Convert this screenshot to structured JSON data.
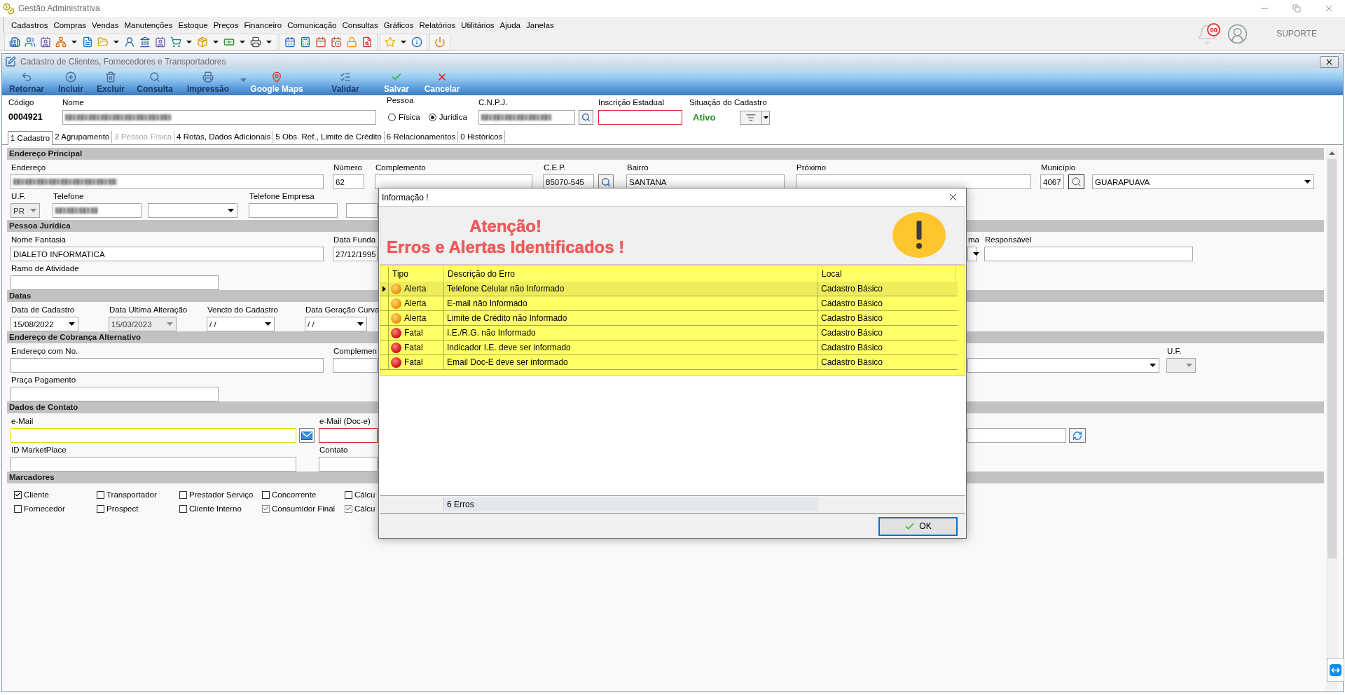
{
  "window": {
    "title": "Gestão Administrativa"
  },
  "menu": [
    "Cadastros",
    "Compras",
    "Vendas",
    "Manutenções",
    "Estoque",
    "Preços",
    "Financeiro",
    "Comunicação",
    "Consultas",
    "Gráficos",
    "Relatórios",
    "Utilitários",
    "Ajuda",
    "Janelas"
  ],
  "user_area": {
    "notification_count": "00",
    "user_name": "SUPORTE"
  },
  "form_window": {
    "title": "Cadastro de Clientes, Fornecedores e Transportadores",
    "toolbar": [
      {
        "label": "Retornar",
        "disabled": true
      },
      {
        "label": "Incluir",
        "disabled": true
      },
      {
        "label": "Excluir",
        "disabled": true
      },
      {
        "label": "Consulta",
        "disabled": true
      },
      {
        "label": "Impressão",
        "disabled": true,
        "dropdown": true
      },
      {
        "label": "Google Maps",
        "disabled": false
      },
      {
        "label": "Validar",
        "disabled": true
      },
      {
        "label": "Salvar",
        "disabled": false
      },
      {
        "label": "Cancelar",
        "disabled": false
      }
    ],
    "header": {
      "code": {
        "label": "Código",
        "value": "0004921"
      },
      "name": {
        "label": "Nome",
        "redacted": true
      },
      "person": {
        "label": "Pessoa",
        "options": [
          {
            "label": "Física",
            "selected": false
          },
          {
            "label": "Jurídica",
            "selected": true
          }
        ]
      },
      "cnpj": {
        "label": "C.N.P.J.",
        "redacted": true
      },
      "state_registration": {
        "label": "Inscrição Estadual",
        "error": true
      },
      "status": {
        "label": "Situação do Cadastro",
        "value": "Ativo"
      }
    },
    "tabs": [
      {
        "label": "1 Cadastro",
        "selected": true,
        "disabled": false
      },
      {
        "label": "2 Agrupamento",
        "selected": false,
        "disabled": false
      },
      {
        "label": "3 Pessoa Física",
        "selected": false,
        "disabled": true
      },
      {
        "label": "4 Rotas, Dados Adicionais",
        "selected": false,
        "disabled": false
      },
      {
        "label": "5 Obs. Ref., Limite de Crédito",
        "selected": false,
        "disabled": false
      },
      {
        "label": "6 Relacionamentos",
        "selected": false,
        "disabled": false
      },
      {
        "label": "0 Históricos",
        "selected": false,
        "disabled": false
      }
    ],
    "sections": [
      {
        "title": "Endereço Principal",
        "rows": [
          [
            {
              "label": "Endereço",
              "kind": "text",
              "redacted": true
            },
            {
              "label": "Número",
              "kind": "text",
              "value": "62"
            },
            {
              "label": "Complemento",
              "kind": "text"
            },
            {
              "label": "C.E.P.",
              "kind": "lookup",
              "value": "85070-545"
            },
            {
              "label": "Bairro",
              "kind": "text",
              "value": "SANTANA"
            },
            {
              "label": "Próximo",
              "kind": "text"
            },
            {
              "label": "Município",
              "kind": "city",
              "code": "4067",
              "value": "GUARAPUAVA"
            }
          ],
          [
            {
              "label": "U.F.",
              "kind": "select",
              "value": "PR",
              "disabled": true
            },
            {
              "label": "Telefone",
              "kind": "text",
              "redacted": true
            },
            {
              "kind": "select"
            },
            {
              "label": "Telefone Empresa",
              "kind": "text"
            },
            {
              "kind": "text"
            }
          ]
        ]
      },
      {
        "title": "Pessoa Jurídica",
        "rows": [
          [
            {
              "label": "Nome Fantasia",
              "kind": "text",
              "value": "DIALETO INFORMATICA"
            },
            {
              "label": "Data Funda",
              "kind": "text",
              "value": "27/12/1995"
            },
            {
              "label": "ma",
              "kind": "select"
            },
            {
              "label": "Responsável",
              "kind": "text"
            }
          ],
          [
            {
              "label": "Ramo de Atividade",
              "kind": "text"
            }
          ]
        ]
      },
      {
        "title": "Datas",
        "rows": [
          [
            {
              "label": "Data de Cadastro",
              "kind": "date",
              "value": "15/08/2022"
            },
            {
              "label": "Data Ultima Alteração",
              "kind": "date",
              "value": "15/03/2023",
              "disabled": true
            },
            {
              "label": "Vencto do Cadastro",
              "kind": "date",
              "value": "/ /"
            },
            {
              "label": "Data Geração Curva",
              "kind": "date",
              "value": "/ /"
            }
          ]
        ]
      },
      {
        "title": "Endereço de Cobrança Alternativo",
        "rows": [
          [
            {
              "label": "Endereço com No.",
              "kind": "text"
            },
            {
              "label": "Complemen",
              "kind": "text"
            },
            {
              "kind": "select"
            },
            {
              "label": "U.F.",
              "kind": "select",
              "disabled": true
            }
          ],
          [
            {
              "label": "Praça Pagamento",
              "kind": "text"
            }
          ]
        ]
      },
      {
        "title": "Dados de Contato",
        "rows": [
          [
            {
              "label": "e-Mail",
              "kind": "email",
              "warning": true
            },
            {
              "label": "e-Mail (Doc-e)",
              "kind": "text",
              "error": true
            },
            {
              "kind": "web"
            }
          ],
          [
            {
              "label": "ID MarketPlace",
              "kind": "text"
            },
            {
              "label": "Contato",
              "kind": "text"
            }
          ]
        ]
      },
      {
        "title": "Marcadores",
        "checkboxes": [
          {
            "label": "Cliente",
            "checked": true,
            "disabled": false
          },
          {
            "label": "Transportador",
            "checked": false,
            "disabled": false
          },
          {
            "label": "Prestador Serviço",
            "checked": false,
            "disabled": false
          },
          {
            "label": "Concorrente",
            "checked": false,
            "disabled": false
          },
          {
            "label": "Cálcu",
            "checked": false,
            "disabled": false
          },
          {
            "label": "Fornecedor",
            "checked": false,
            "disabled": false
          },
          {
            "label": "Prospect",
            "checked": false,
            "disabled": false
          },
          {
            "label": "Cliente Interno",
            "checked": false,
            "disabled": false
          },
          {
            "label": "Consumidor Final",
            "checked": true,
            "disabled": true
          },
          {
            "label": "Cálcu",
            "checked": true,
            "disabled": true
          }
        ]
      }
    ]
  },
  "dialog": {
    "title": "Informação !",
    "heading": [
      "Atenção!",
      "Erros e Alertas Identificados !"
    ],
    "columns": [
      "Tipo",
      "Descrição do Erro",
      "Local"
    ],
    "rows": [
      {
        "kind": "alert",
        "type": "Alerta",
        "description": "Telefone Celular não Informado",
        "location": "Cadastro Básico",
        "selected": true
      },
      {
        "kind": "alert",
        "type": "Alerta",
        "description": "E-mail não Informado",
        "location": "Cadastro Básico",
        "selected": false
      },
      {
        "kind": "alert",
        "type": "Alerta",
        "description": "Limite de Crédito não Informado",
        "location": "Cadastro Básico",
        "selected": false
      },
      {
        "kind": "fatal",
        "type": "Fatal",
        "description": "I.E./R.G. não Informado",
        "location": "Cadastro Básico",
        "selected": false
      },
      {
        "kind": "fatal",
        "type": "Fatal",
        "description": "Indicador I.E. deve ser informado",
        "location": "Cadastro Básico",
        "selected": false
      },
      {
        "kind": "fatal",
        "type": "Fatal",
        "description": "Email Doc-E deve ser informado",
        "location": "Cadastro Básico",
        "selected": false
      }
    ],
    "footer": "6 Erros",
    "ok_button": "OK"
  }
}
